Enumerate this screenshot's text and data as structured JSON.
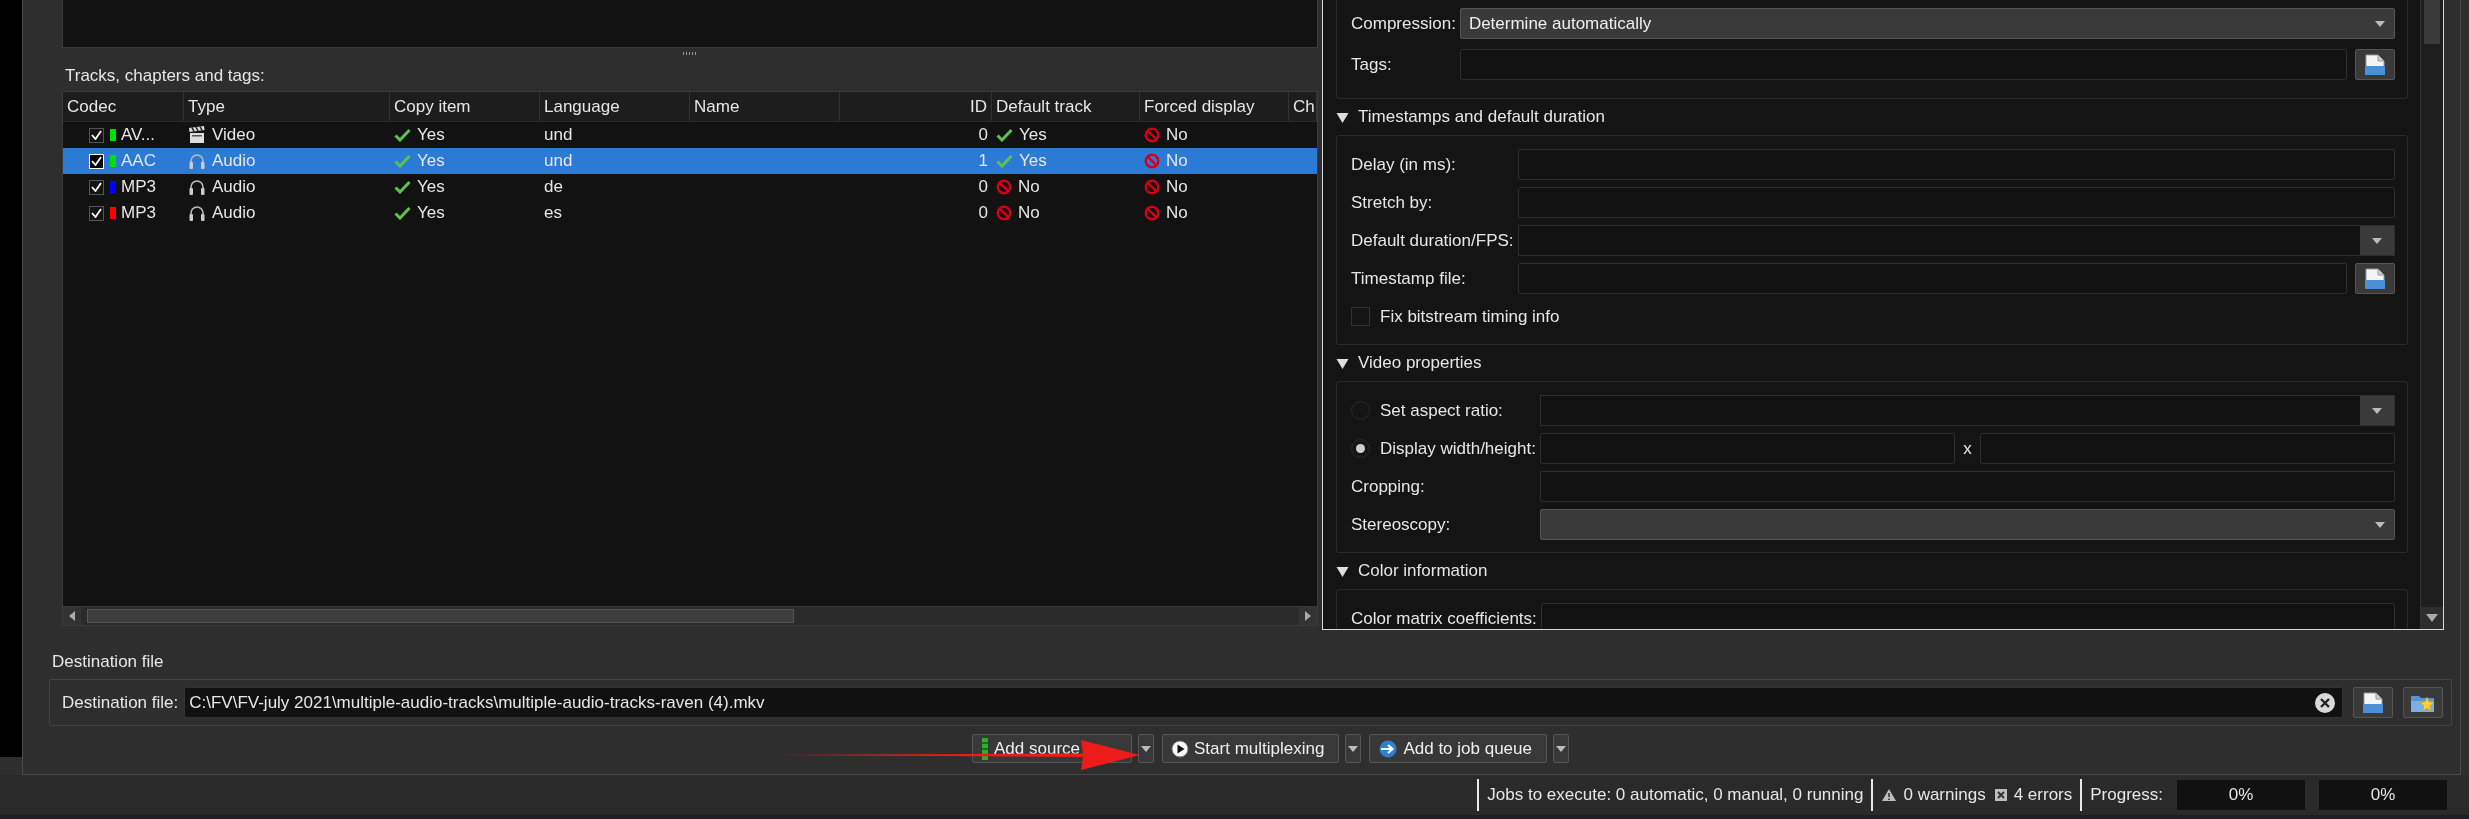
{
  "tracks_label": "Tracks, chapters and tags:",
  "track_table": {
    "columns": [
      "Codec",
      "Type",
      "Copy item",
      "Language",
      "Name",
      "ID",
      "Default track",
      "Forced display",
      "Ch"
    ],
    "rows": [
      {
        "selected": false,
        "checked": true,
        "color": "#00e000",
        "codec": "AV...",
        "kind": "video",
        "type": "Video",
        "copy_item": {
          "value": "Yes",
          "on": true
        },
        "language": "und",
        "id": "0",
        "default_track": {
          "value": "Yes",
          "on": true
        },
        "forced_display": {
          "value": "No",
          "on": false
        }
      },
      {
        "selected": true,
        "checked": true,
        "color": "#00e000",
        "codec": "AAC",
        "kind": "audio",
        "type": "Audio",
        "copy_item": {
          "value": "Yes",
          "on": true
        },
        "language": "und",
        "id": "1",
        "default_track": {
          "value": "Yes",
          "on": true
        },
        "forced_display": {
          "value": "No",
          "on": false
        }
      },
      {
        "selected": false,
        "checked": true,
        "color": "#0000ff",
        "codec": "MP3",
        "kind": "audio",
        "type": "Audio",
        "copy_item": {
          "value": "Yes",
          "on": true
        },
        "language": "de",
        "id": "0",
        "default_track": {
          "value": "No",
          "on": false
        },
        "forced_display": {
          "value": "No",
          "on": false
        }
      },
      {
        "selected": false,
        "checked": true,
        "color": "#ff0000",
        "codec": "MP3",
        "kind": "audio",
        "type": "Audio",
        "copy_item": {
          "value": "Yes",
          "on": true
        },
        "language": "es",
        "id": "0",
        "default_track": {
          "value": "No",
          "on": false
        },
        "forced_display": {
          "value": "No",
          "on": false
        }
      }
    ]
  },
  "properties": {
    "sections": [
      {
        "fields": [
          {
            "kind": "dropdown",
            "label": "Compression:",
            "value": "Determine automatically"
          },
          {
            "kind": "file",
            "label": "Tags:"
          }
        ]
      },
      {
        "title": "Timestamps and default duration",
        "expanded": true,
        "fields": [
          {
            "kind": "text",
            "label": "Delay (in ms):"
          },
          {
            "kind": "text",
            "label": "Stretch by:"
          },
          {
            "kind": "combo",
            "label": "Default duration/FPS:"
          },
          {
            "kind": "file",
            "label": "Timestamp file:"
          },
          {
            "kind": "checkbox",
            "label": "Fix bitstream timing info",
            "checked": false
          }
        ]
      },
      {
        "title": "Video properties",
        "expanded": true,
        "fields": [
          {
            "kind": "radio_combo",
            "label": "Set aspect ratio:",
            "selected": false
          },
          {
            "kind": "radio_pair",
            "label": "Display width/height:",
            "selected": true,
            "separator": "x"
          },
          {
            "kind": "text",
            "label": "Cropping:"
          },
          {
            "kind": "dropdown",
            "label": "Stereoscopy:"
          }
        ]
      },
      {
        "title": "Color information",
        "expanded": true,
        "fields": [
          {
            "kind": "text",
            "label": "Color matrix coefficients:"
          }
        ]
      }
    ]
  },
  "destination": {
    "group_title": "Destination file",
    "label": "Destination file:",
    "value": "C:\\FV\\FV-july 2021\\multiple-audio-tracks\\multiple-audio-tracks-raven (4).mkv"
  },
  "actions": [
    {
      "kind": "add",
      "label": "Add source"
    },
    {
      "kind": "start",
      "label": "Start multiplexing"
    },
    {
      "kind": "queue",
      "label": "Add to job queue"
    }
  ],
  "status_bar": {
    "jobs": "Jobs to execute: 0 automatic, 0 manual, 0 running",
    "warnings": "0 warnings",
    "errors": "4 errors",
    "progress_label": "Progress:",
    "progress": [
      {
        "text": "0%",
        "level": 0
      },
      {
        "text": "0%",
        "level": 0
      }
    ]
  }
}
